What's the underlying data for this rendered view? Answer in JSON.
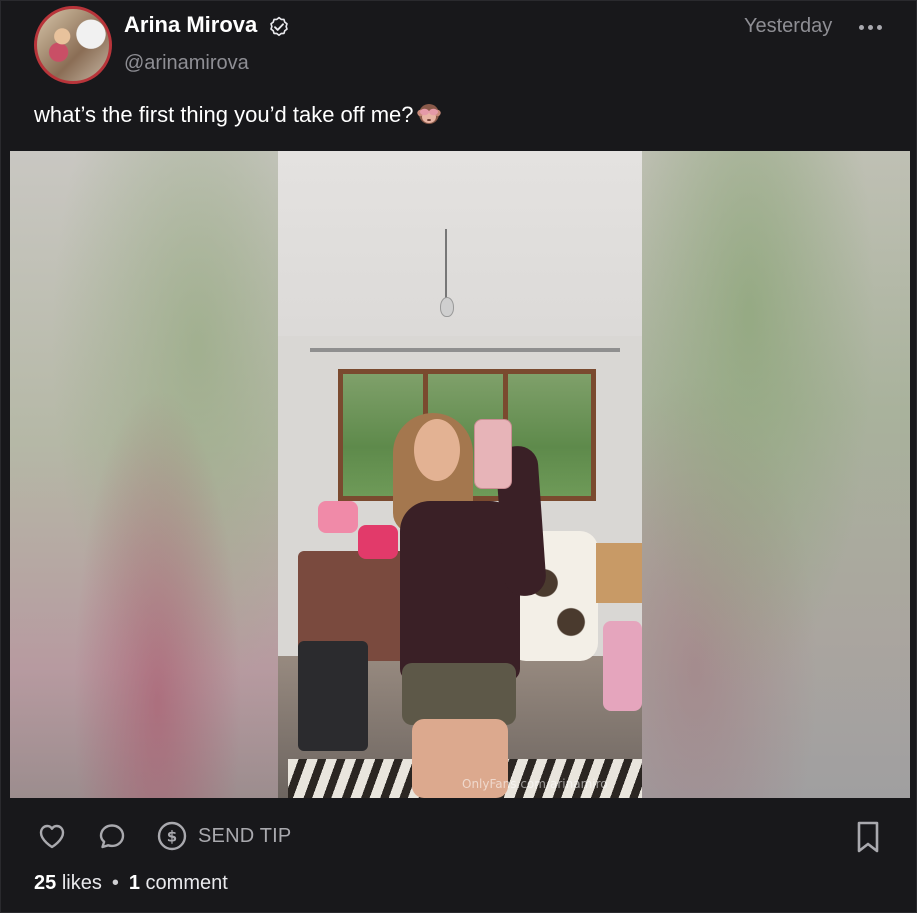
{
  "post": {
    "author": {
      "display_name": "Arina Mirova",
      "handle": "@arinamirova",
      "verified": true
    },
    "timestamp": "Yesterday",
    "caption": "what’s the first thing you’d take off me?",
    "caption_emoji_icon": "see-no-evil-monkey-icon",
    "media": {
      "watermark": "OnlyFans.com/arinamiro"
    },
    "actions": {
      "tip_label": "SEND TIP"
    },
    "stats": {
      "likes_count": "25",
      "likes_label": "likes",
      "separator": "•",
      "comments_count": "1",
      "comments_label": "comment"
    }
  },
  "colors": {
    "background": "#18181b",
    "text_primary": "#ffffff",
    "text_secondary": "#8e8e94",
    "icon": "#a9a9ae",
    "avatar_ring": "#b8343a"
  }
}
